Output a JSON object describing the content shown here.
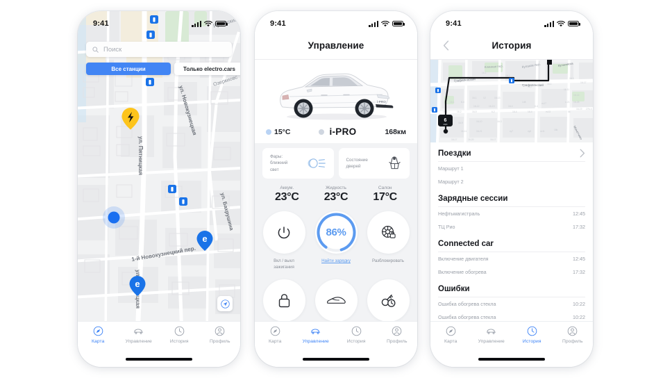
{
  "statusbar": {
    "time": "9:41"
  },
  "colors": {
    "accent": "#3b82f6",
    "segment_active": "#4285f4",
    "battery_ring": "#5c9bf0",
    "pin_charge": "#fdc41b",
    "pin_station": "#1a73e8",
    "muted_text": "#9ba0a9"
  },
  "phone1": {
    "name": "map-screen",
    "search": {
      "placeholder": "Поиск",
      "icon": "search-icon"
    },
    "segments": [
      {
        "label": "Все станции",
        "active": true
      },
      {
        "label": "Только electro.cars",
        "active": false
      }
    ],
    "locate_button": {
      "icon": "navigate-arrow-icon"
    },
    "map_labels": [
      "Руновский",
      "Озеркиовс",
      "ул. Пятницкая",
      "ул. Новокузнецкая",
      "ул. Бахрушина",
      "1-й Новокузнецкий пер."
    ],
    "markers": [
      {
        "type": "charge-pin",
        "icon": "lightning-icon"
      },
      {
        "type": "station-pin",
        "icon": "electro-icon"
      },
      {
        "type": "station-pin",
        "icon": "electro-icon"
      },
      {
        "type": "user-location",
        "icon": "blue-dot"
      }
    ],
    "tabs": [
      {
        "label": "Карта",
        "icon": "compass-icon",
        "active": true
      },
      {
        "label": "Управление",
        "icon": "car-icon",
        "active": false
      },
      {
        "label": "История",
        "icon": "clock-icon",
        "active": false
      },
      {
        "label": "Профиль",
        "icon": "person-icon",
        "active": false
      }
    ]
  },
  "phone2": {
    "name": "control-screen",
    "title": "Управление",
    "car": {
      "alt": "white-sedan-photo"
    },
    "status": {
      "outside_temp": "15°C",
      "temp_icon": "thermometer-dot-icon",
      "model": "i-PRO",
      "model_dot_icon": "status-dot-icon",
      "range": "168км"
    },
    "info_cards": [
      {
        "label": "Фары:\nближний\nсвет",
        "icon": "headlight-icon"
      },
      {
        "label": "Состояние\nдверей",
        "icon": "door-open-icon"
      }
    ],
    "temperatures": [
      {
        "caption": "Аккум.",
        "value": "23°C"
      },
      {
        "caption": "Жидкость",
        "value": "23°C"
      },
      {
        "caption": "Салон",
        "value": "17°C"
      }
    ],
    "actions_row1": [
      {
        "label": "Вкл / выкл\nзажигания",
        "icon": "power-icon",
        "kind": "icon"
      },
      {
        "label": "Найти зарядку",
        "value": "86%",
        "icon": "battery-ring",
        "kind": "ring",
        "link": true
      },
      {
        "label": "Разблокировать",
        "icon": "wheel-lock-icon",
        "kind": "icon"
      }
    ],
    "actions_row2": [
      {
        "label": "",
        "icon": "lock-icon",
        "kind": "icon"
      },
      {
        "label": "",
        "icon": "car-outline-icon",
        "kind": "icon"
      },
      {
        "label": "",
        "icon": "key-clock-icon",
        "kind": "icon"
      }
    ],
    "tabs": [
      {
        "label": "Карта",
        "icon": "compass-icon",
        "active": false
      },
      {
        "label": "Управление",
        "icon": "car-icon",
        "active": true
      },
      {
        "label": "История",
        "icon": "clock-icon",
        "active": false
      },
      {
        "label": "Профиль",
        "icon": "person-icon",
        "active": false
      }
    ]
  },
  "phone3": {
    "name": "history-screen",
    "title": "История",
    "back_icon": "chevron-left-icon",
    "map": {
      "route_badge": "6",
      "route_badge_unit": "мин",
      "labels": [
        "Кулаков пер.",
        "Клинная пер.",
        "Графиленский",
        "Графиленский",
        "Монетчико"
      ]
    },
    "sections": [
      {
        "title": "Поездки",
        "chevron": "chevron-right-icon",
        "rows": [
          {
            "label": "Маршрут 1",
            "time": ""
          },
          {
            "label": "Маршрут 2",
            "time": ""
          }
        ]
      },
      {
        "title": "Зарядные сессии",
        "chevron": "",
        "rows": [
          {
            "label": "Нефтьмагистраль",
            "time": "12:45"
          },
          {
            "label": "ТЦ Рио",
            "time": "17:32"
          }
        ]
      },
      {
        "title": "Connected car",
        "chevron": "",
        "rows": [
          {
            "label": "Включение двигателя",
            "time": "12:45"
          },
          {
            "label": "Включение обогрева",
            "time": "17:32"
          }
        ]
      },
      {
        "title": "Ошибки",
        "chevron": "",
        "rows": [
          {
            "label": "Ошибка обогрева стекла",
            "time": "10:22"
          },
          {
            "label": "Ошибка обогрева стекла",
            "time": "10:22"
          }
        ]
      }
    ],
    "tabs": [
      {
        "label": "Карта",
        "icon": "compass-icon",
        "active": false
      },
      {
        "label": "Управление",
        "icon": "car-icon",
        "active": false
      },
      {
        "label": "История",
        "icon": "clock-icon",
        "active": true
      },
      {
        "label": "Профиль",
        "icon": "person-icon",
        "active": false
      }
    ]
  }
}
